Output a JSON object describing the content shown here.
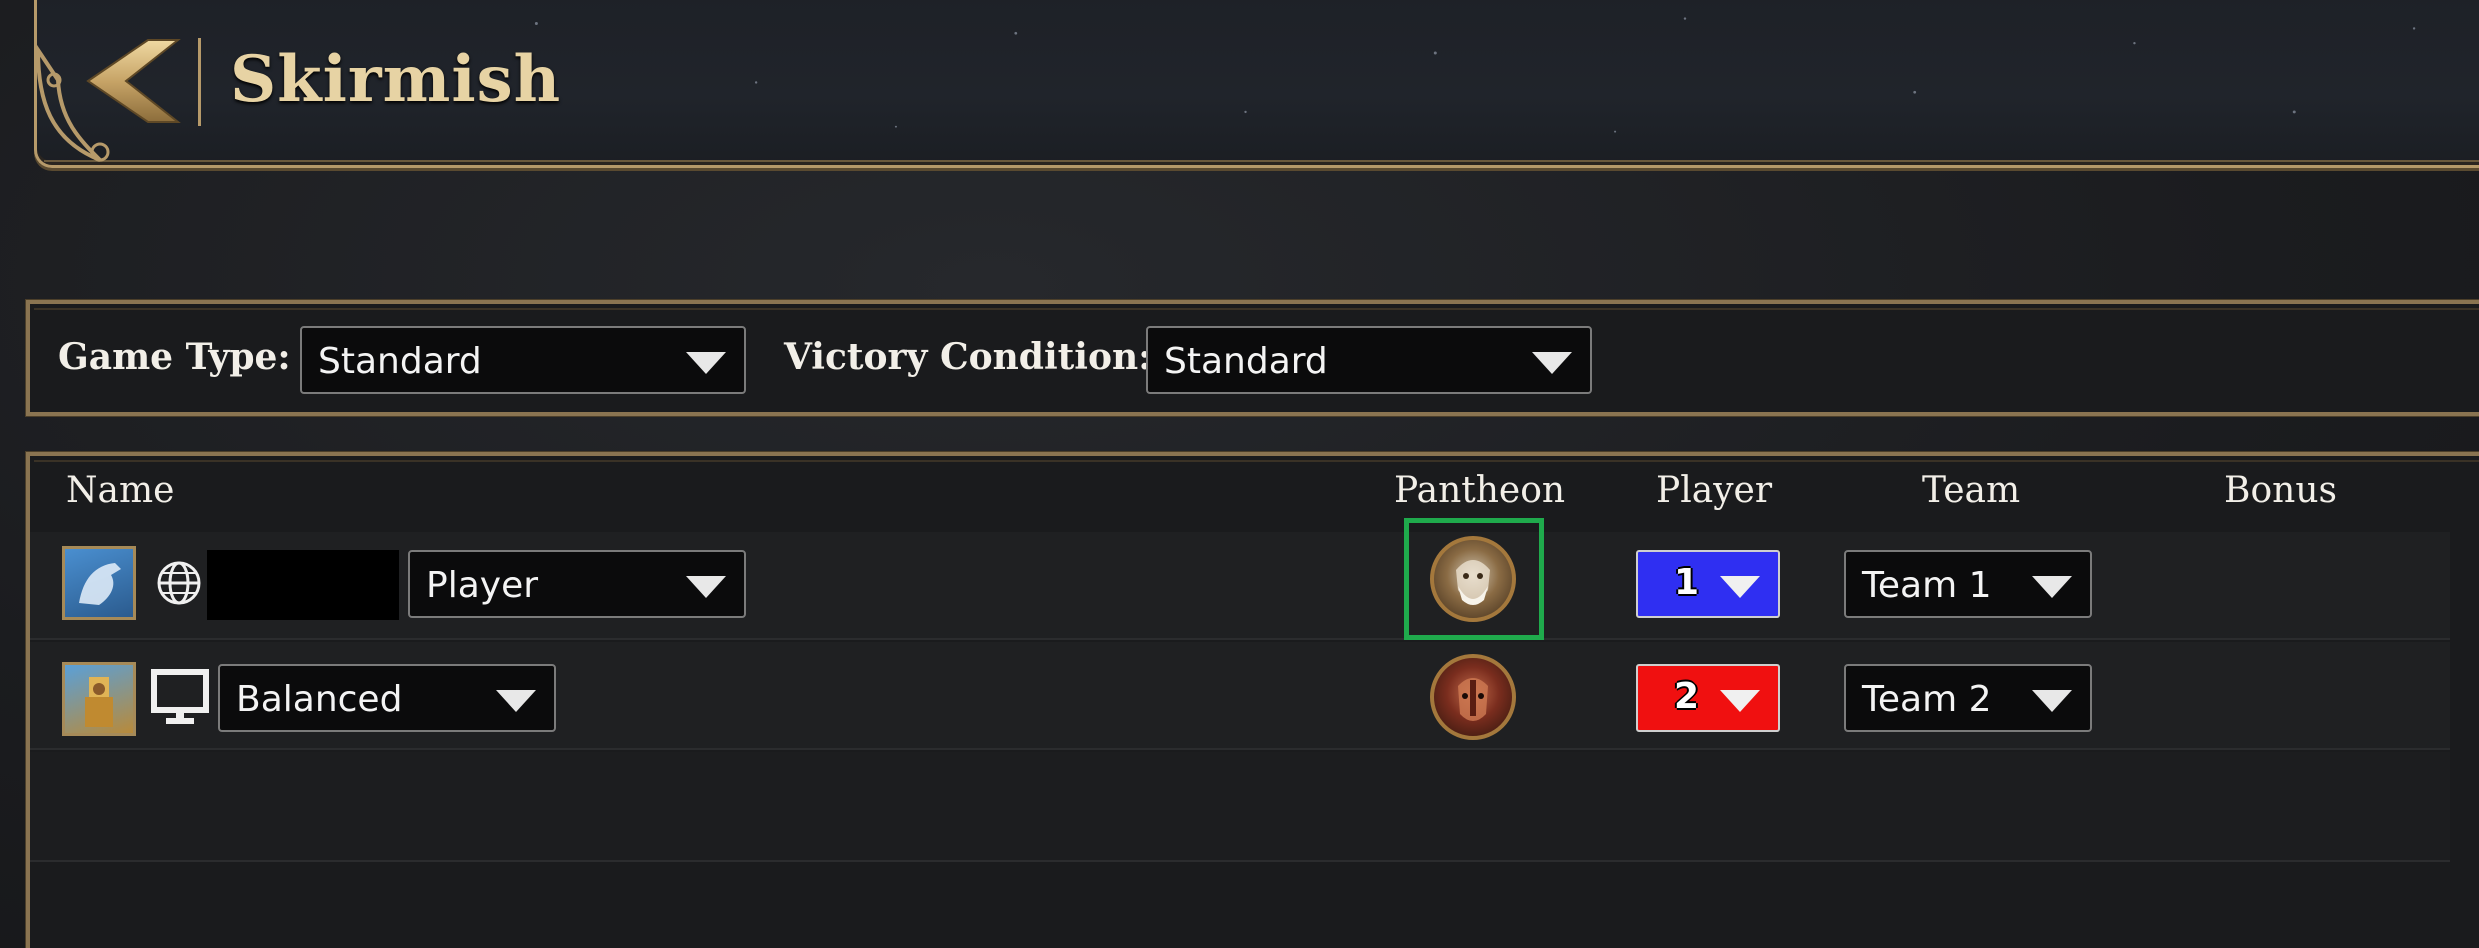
{
  "header": {
    "title": "Skirmish",
    "back_icon": "back-chevron-icon"
  },
  "settings": {
    "game_type_label": "Game Type:",
    "game_type_value": "Standard",
    "victory_label": "Victory Condition:",
    "victory_value": "Standard"
  },
  "columns": {
    "name": "Name",
    "pantheon": "Pantheon",
    "player": "Player",
    "team": "Team",
    "bonus": "Bonus"
  },
  "rows": [
    {
      "type_icon": "globe-icon",
      "controller": "Player",
      "player_number": "1",
      "player_color": "#2f2ff2",
      "team": "Team 1",
      "pantheon_selected": true
    },
    {
      "type_icon": "computer-monitor-icon",
      "controller": "Balanced",
      "player_number": "2",
      "player_color": "#f01010",
      "team": "Team 2",
      "pantheon_selected": false
    }
  ],
  "colors": {
    "accent_gold": "#b69a6a",
    "selection_green": "#1faa4c"
  }
}
